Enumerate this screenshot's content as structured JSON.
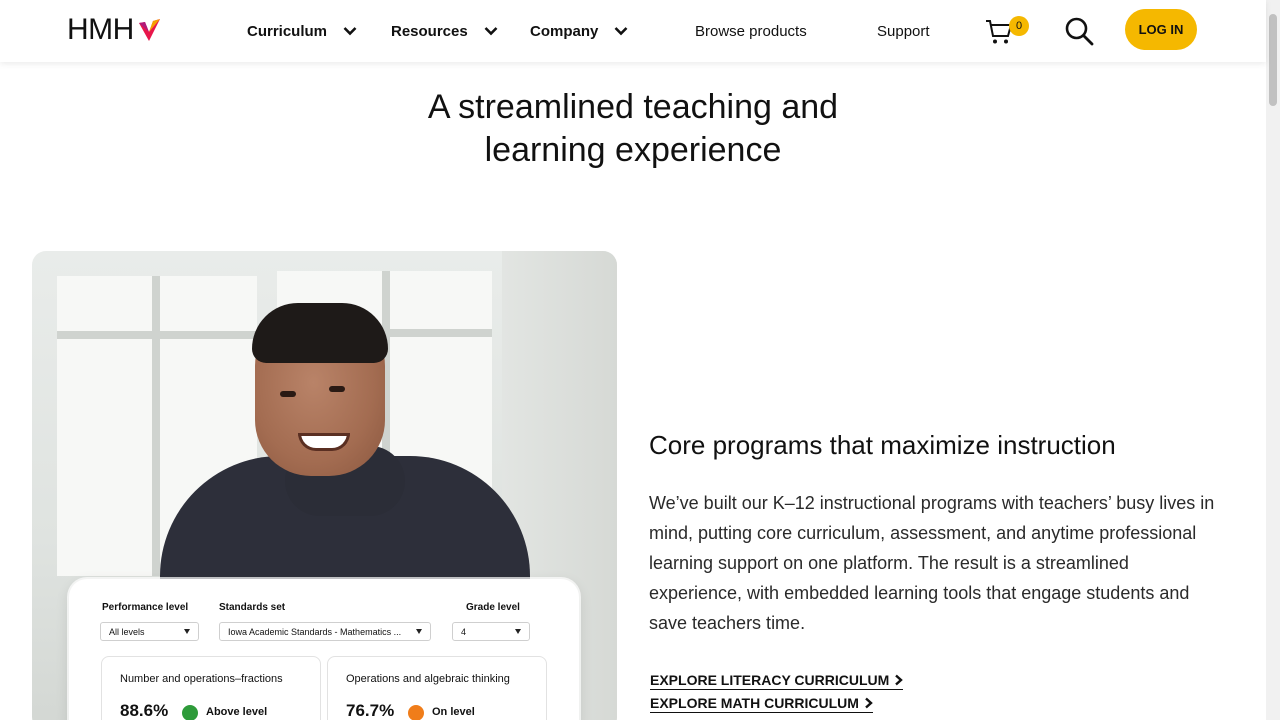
{
  "header": {
    "logo_text": "HMH",
    "nav": [
      {
        "label": "Curriculum",
        "has_dropdown": true
      },
      {
        "label": "Resources",
        "has_dropdown": true
      },
      {
        "label": "Company",
        "has_dropdown": true
      }
    ],
    "links": {
      "browse": "Browse products",
      "support": "Support"
    },
    "cart_count": "0",
    "login_label": "LOG IN"
  },
  "hero": {
    "title_line1": "A streamlined teaching and",
    "title_line2": "learning experience"
  },
  "dashboard": {
    "performance_label": "Performance level",
    "performance_value": "All levels",
    "standards_label": "Standards set",
    "standards_value": "Iowa Academic Standards - Mathematics ...",
    "grade_label": "Grade level",
    "grade_value": "4",
    "metrics": [
      {
        "title": "Number and operations–fractions",
        "value": "88.6%",
        "status": "Above level",
        "color": "#2e9b3a"
      },
      {
        "title": "Operations and algebraic thinking",
        "value": "76.7%",
        "status": "On level",
        "color": "#f07d1a"
      }
    ]
  },
  "section": {
    "title": "Core programs that maximize instruction",
    "body": "We’ve built our K–12 instructional programs with teachers’ busy lives in mind, putting core curriculum, assessment, and anytime professional learning support on one platform. The result is a streamlined experience, with embedded learning tools that engage students and save teachers time.",
    "cta_literacy": "EXPLORE LITERACY CURRICULUM",
    "cta_math": "EXPLORE MATH CURRICULUM"
  },
  "colors": {
    "accent": "#f5b800"
  }
}
